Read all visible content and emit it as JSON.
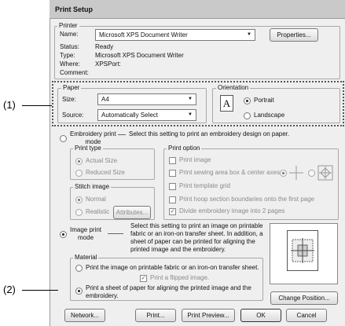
{
  "window": {
    "title": "Print Setup"
  },
  "callouts": {
    "c1": "(1)",
    "c2": "(2)"
  },
  "printer": {
    "group_title": "Printer",
    "name_label": "Name:",
    "name_value": "Microsoft XPS Document Writer",
    "properties_button": "Properties...",
    "status_label": "Status:",
    "status_value": "Ready",
    "type_label": "Type:",
    "type_value": "Microsoft XPS Document Writer",
    "where_label": "Where:",
    "where_value": "XPSPort:",
    "comment_label": "Comment:"
  },
  "paper": {
    "group_title": "Paper",
    "size_label": "Size:",
    "size_value": "A4",
    "source_label": "Source:",
    "source_value": "Automatically Select"
  },
  "orientation": {
    "group_title": "Orientation",
    "icon_letter": "A",
    "portrait": "Portrait",
    "landscape": "Landscape",
    "selected": "Portrait"
  },
  "embroidery": {
    "radio_label": "Embroidery print\nmode",
    "description": "Select this setting to print an embroidery design on paper.",
    "print_type_title": "Print type",
    "actual_size": "Actual Size",
    "reduced_size": "Reduced Size",
    "print_option_title": "Print option",
    "print_image": "Print image",
    "print_sewing_area": "Print sewing area box & center axes",
    "print_template_grid": "Print template grid",
    "print_hoop_section": "Print hoop section boundaries onto the first page",
    "divide_embroidery": "Divide embroidery image into 2 pages",
    "stitch_image_title": "Stitch image",
    "normal": "Normal",
    "realistic": "Realistic",
    "attributes_button": "Attributes..."
  },
  "image_print": {
    "radio_label": "Image print\nmode",
    "description": "Select this setting to print an image on printable fabric or an iron-on transfer sheet. In addition, a sheet of paper can be printed for aligning the printed image and the embroidery.",
    "material_title": "Material",
    "option_fabric": "Print the image on printable fabric or an iron-on transfer sheet.",
    "flipped": "Print a flipped image.",
    "option_sheet": "Print a sheet of paper for aligning the printed image and the embroidery.",
    "change_position_button": "Change Position..."
  },
  "footer": {
    "network": "Network...",
    "print": "Print...",
    "print_preview": "Print Preview...",
    "ok": "OK",
    "cancel": "Cancel"
  }
}
